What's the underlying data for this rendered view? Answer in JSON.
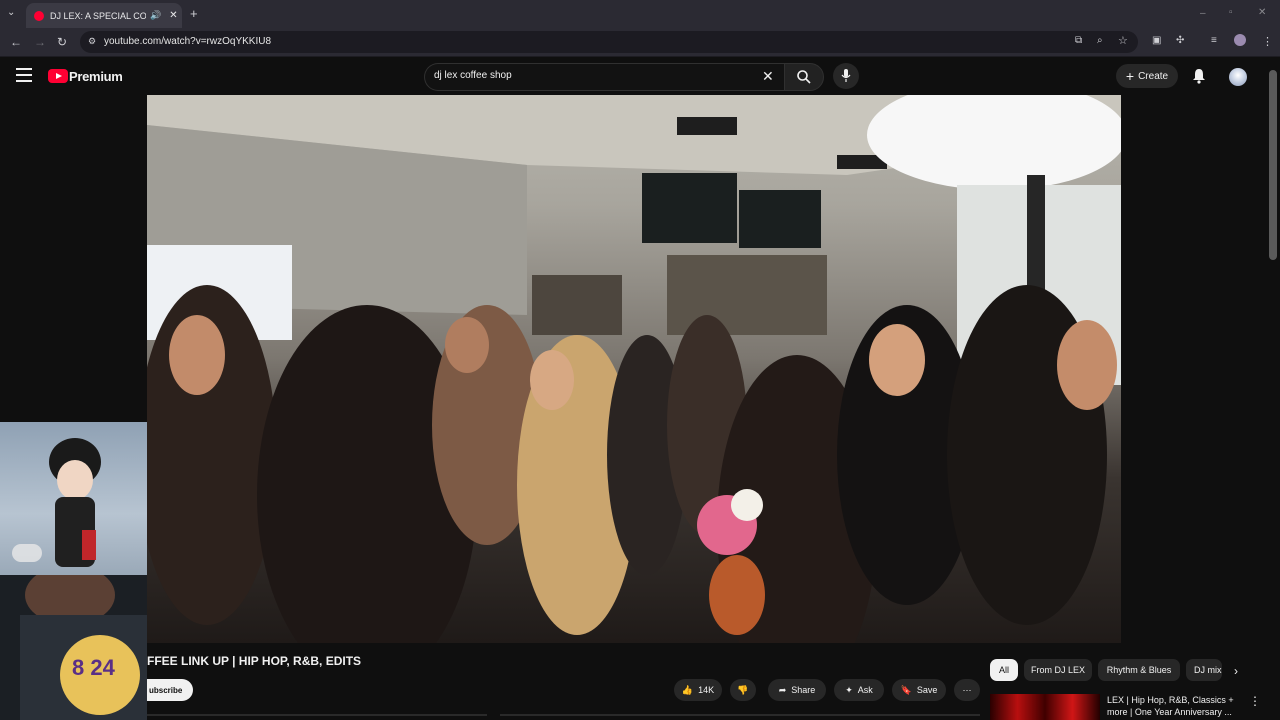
{
  "browser": {
    "tab_title": "DJ LEX: A SPECIAL COFFEE SHOP",
    "url": "youtube.com/watch?v=rwzOqYKKIU8"
  },
  "header": {
    "brand": "Premium",
    "search_value": "dj lex coffee shop",
    "create_label": "Create"
  },
  "video": {
    "title": "FFEE LINK UP | HIP HOP, R&B, EDITS",
    "subscribe_label": "ubscribe"
  },
  "actions": {
    "likes": "14K",
    "share": "Share",
    "ask": "Ask",
    "save": "Save"
  },
  "chips": {
    "all": "All",
    "from": "From DJ LEX",
    "rb": "Rhythm & Blues",
    "dj": "DJ mix"
  },
  "related": {
    "title": "LEX | Hip Hop, R&B, Classics + more | One Year Anniversary ..."
  },
  "overlay": {
    "jersey": "8 24"
  },
  "colors": {
    "brand_red": "#ff0033",
    "background": "#0f0f0f",
    "chip": "#272727"
  }
}
